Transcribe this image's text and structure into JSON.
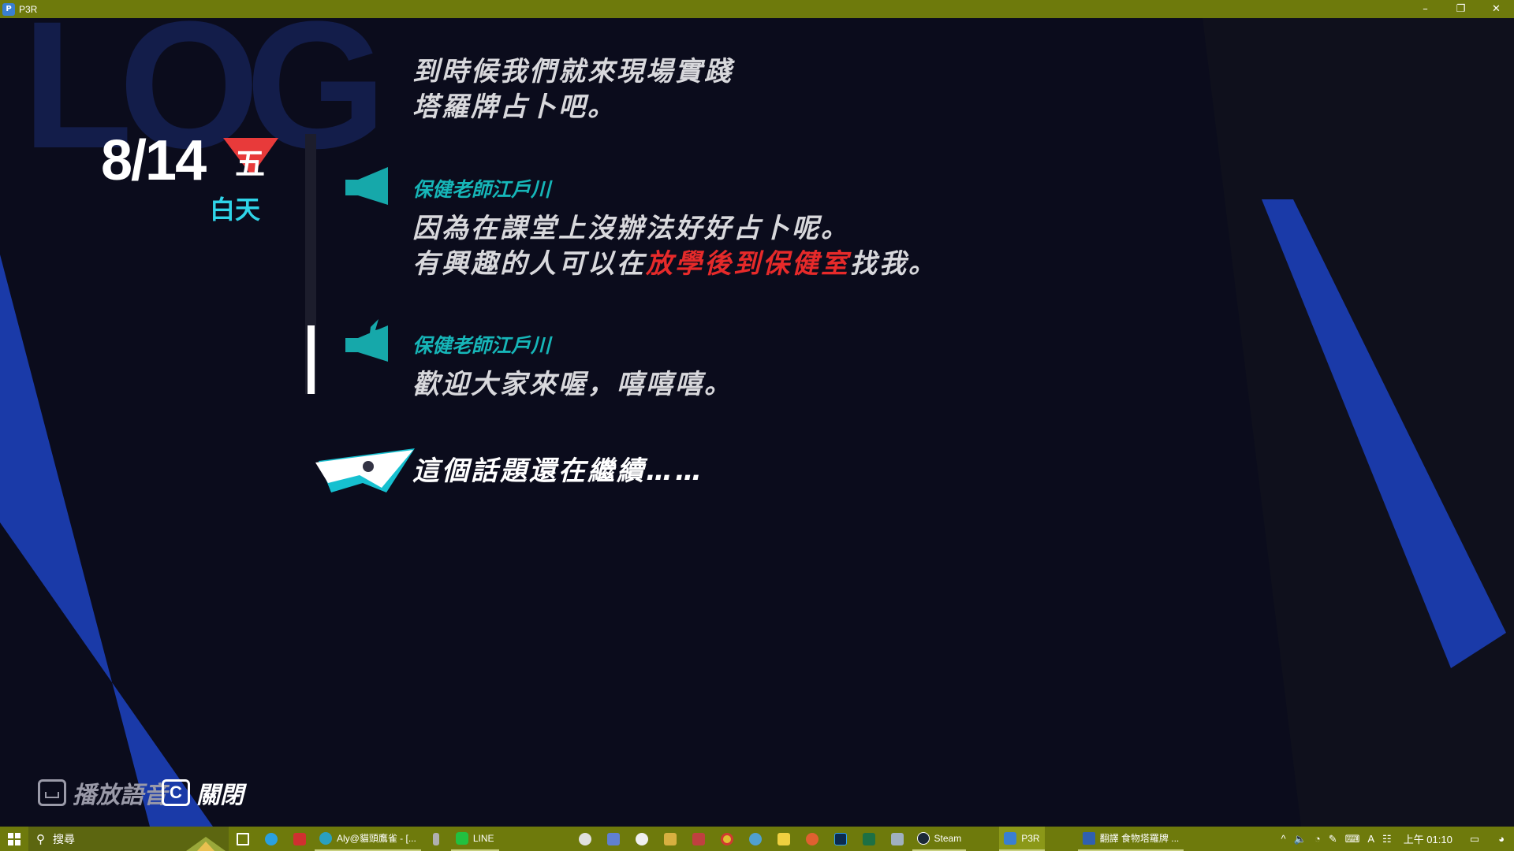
{
  "window": {
    "title": "P3R",
    "minimize": "–",
    "restore": "❐",
    "close": "✕"
  },
  "game": {
    "watermark": "LOG",
    "date": "8/14",
    "weekday": "五",
    "time_of_day": "白天",
    "log": [
      {
        "id": "entry1",
        "lines": [
          "到時候我們就來現場實踐",
          "塔羅牌占卜吧。"
        ]
      },
      {
        "id": "entry2",
        "speaker": "保健老師江戶川",
        "line1": "因為在課堂上沒辦法好好占卜呢。",
        "line2_before": "有興趣的人可以在",
        "line2_highlight": "放學後到保健室",
        "line2_after": "找我。"
      },
      {
        "id": "entry3",
        "speaker": "保健老師江戶川",
        "line1": "歡迎大家來喔，嘻嘻嘻。"
      }
    ],
    "continue_text": "這個話題還在繼續……",
    "hints": {
      "play_voice_label": "播放語音",
      "close_key": "C",
      "close_label": "關閉"
    },
    "colors": {
      "speaker": "#16b6b8",
      "highlight": "#e62a2a",
      "accent_blue": "#1a3aa8",
      "weekday_badge": "#e83a3a"
    }
  },
  "taskbar": {
    "search_placeholder": "搜尋",
    "apps": [
      {
        "label": "Aly@貓頭鷹雀 - [..."
      },
      {
        "label": "LINE"
      },
      {
        "label": "Steam"
      },
      {
        "label": "P3R"
      },
      {
        "label": "翻譯 食物塔羅牌 ..."
      }
    ],
    "tray": {
      "ime": "A",
      "clock": "上午 01:10"
    }
  }
}
